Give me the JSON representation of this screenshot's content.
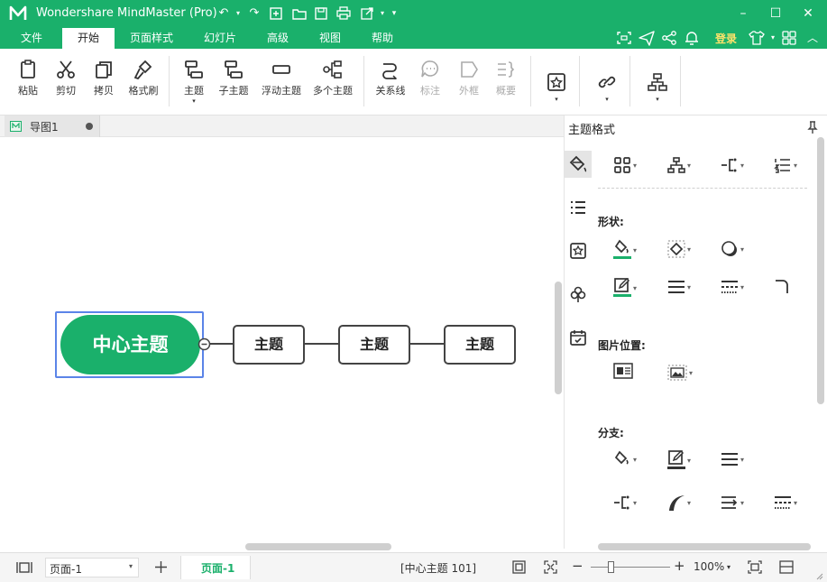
{
  "app": {
    "title": "Wondershare MindMaster (Pro)"
  },
  "menu": {
    "tabs": [
      "文件",
      "开始",
      "页面样式",
      "幻灯片",
      "高级",
      "视图",
      "帮助"
    ],
    "active_tab": "开始",
    "login": "登录"
  },
  "ribbon": {
    "paste": "粘贴",
    "cut": "剪切",
    "copy": "拷贝",
    "format_painter": "格式刷",
    "topic": "主题",
    "subtopic": "子主题",
    "floating_topic": "浮动主题",
    "multiple_topics": "多个主题",
    "relationship": "关系线",
    "callout": "标注",
    "boundary": "外框",
    "summary": "概要"
  },
  "document": {
    "tab_name": "导图1"
  },
  "canvas": {
    "central_topic": "中心主题",
    "topics": [
      "主题",
      "主题",
      "主题"
    ]
  },
  "panel": {
    "title": "主题格式",
    "shape_label": "形状:",
    "image_position_label": "图片位置:",
    "branch_label": "分支:"
  },
  "status": {
    "page_select": "页面-1",
    "page_tab": "页面-1",
    "selection_info": "[中心主题 101]",
    "zoom": "100%"
  },
  "colors": {
    "brand": "#1ab06b",
    "login": "#ffe36b",
    "selection": "#5b84e8"
  }
}
